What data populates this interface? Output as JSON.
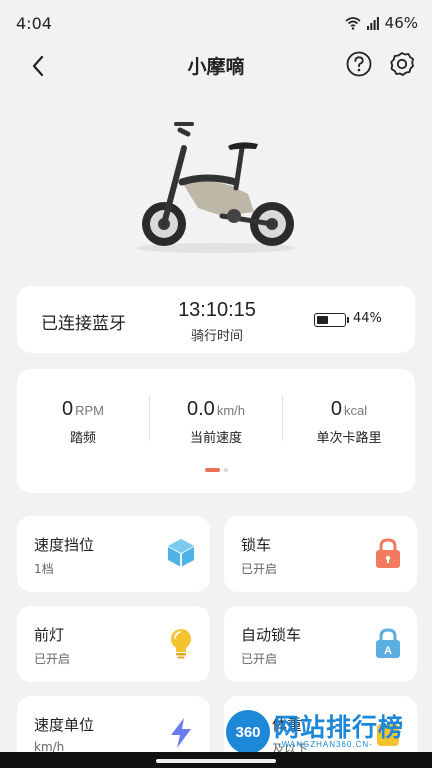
{
  "status_bar": {
    "time": "4:04",
    "battery": "46%"
  },
  "header": {
    "title": "小摩嘀",
    "back_icon": "chevron-left-icon",
    "help_icon": "help-circle-icon",
    "settings_icon": "gear-icon"
  },
  "connection": {
    "bluetooth_status": "已连接蓝牙",
    "ride_time": "13:10:15",
    "ride_time_label": "骑行时间",
    "battery_percent": "44%",
    "battery_level": 0.44
  },
  "stats": [
    {
      "value": "0",
      "unit": "RPM",
      "label": "踏频"
    },
    {
      "value": "0.0",
      "unit": "km/h",
      "label": "当前速度"
    },
    {
      "value": "0",
      "unit": "kcal",
      "label": "单次卡路里"
    }
  ],
  "pager": {
    "active_index": 0,
    "count": 2,
    "active_color": "#ef6f55"
  },
  "tiles": [
    {
      "title": "速度挡位",
      "subtitle": "1档",
      "icon": "cube-icon",
      "color": "#4fb3e8"
    },
    {
      "title": "锁车",
      "subtitle": "已开启",
      "icon": "lock-icon",
      "color": "#f27a5e"
    },
    {
      "title": "前灯",
      "subtitle": "已开启",
      "icon": "lightbulb-icon",
      "color": "#f4c430"
    },
    {
      "title": "自动锁车",
      "subtitle": "已开启",
      "icon": "auto-lock-icon",
      "color": "#5aaee0"
    },
    {
      "title": "速度单位",
      "subtitle": "km/h",
      "icon": "lightning-icon",
      "color": "#6b7cf2"
    },
    {
      "title": "体重",
      "subtitle": "及以下",
      "icon": "weight-icon",
      "color": "#f4c430"
    }
  ],
  "watermark": {
    "logo": "360",
    "title": "网站排行榜",
    "url": "-WANGZHAN360.CN-"
  }
}
